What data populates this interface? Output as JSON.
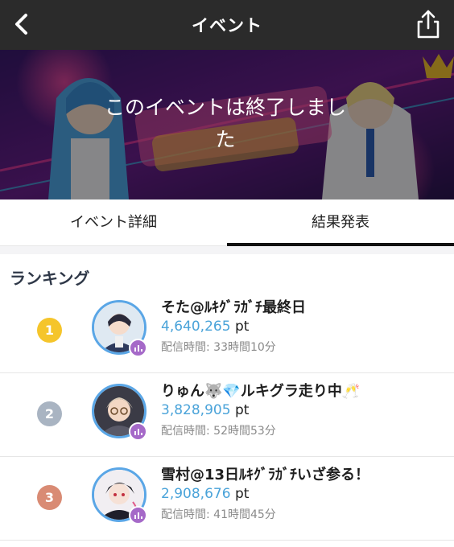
{
  "header": {
    "title": "イベント",
    "back_icon": "chevron-left-icon",
    "share_icon": "share-icon"
  },
  "banner": {
    "status_text": "このイベントは終了しました"
  },
  "tabs": [
    {
      "label": "イベント詳細",
      "selected": false
    },
    {
      "label": "結果発表",
      "selected": true
    }
  ],
  "ranking": {
    "title": "ランキング",
    "entries": [
      {
        "rank": "1",
        "rank_color": "#f5c52b",
        "name": "そた@ﾙｷｸﾞﾗｶﾞﾁ最終日",
        "points": "4,640,265",
        "unit": "pt",
        "duration_label": "配信時間:",
        "duration": "33時間10分"
      },
      {
        "rank": "2",
        "rank_color": "#a9b4c2",
        "name": "りゅん🐺💎ルキグラ走り中🥂",
        "points": "3,828,905",
        "unit": "pt",
        "duration_label": "配信時間:",
        "duration": "52時間53分"
      },
      {
        "rank": "3",
        "rank_color": "#d98b74",
        "name": "雪村@13日ﾙｷｸﾞﾗｶﾞﾁいざ参る！",
        "points": "2,908,676",
        "unit": "pt",
        "duration_label": "配信時間:",
        "duration": "41時間45分"
      }
    ]
  }
}
